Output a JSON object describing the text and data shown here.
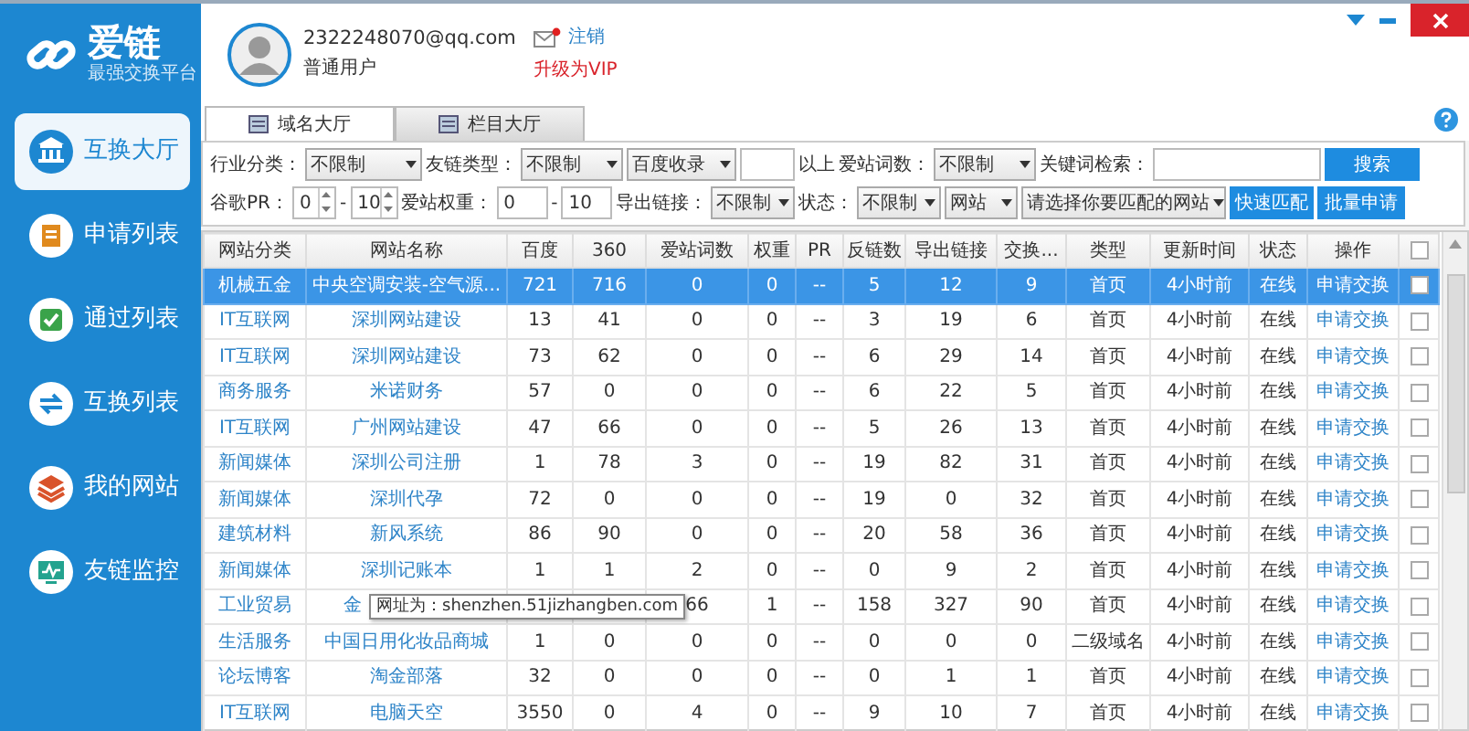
{
  "app": {
    "logo": "爱链",
    "tagline": "最强交换平台"
  },
  "sidebar": {
    "items": [
      {
        "label": "互换大厅",
        "selected": true,
        "kind": "bank"
      },
      {
        "label": "申请列表",
        "selected": false,
        "kind": "apply"
      },
      {
        "label": "通过列表",
        "selected": false,
        "kind": "check"
      },
      {
        "label": "互换列表",
        "selected": false,
        "kind": "swap"
      },
      {
        "label": "我的网站",
        "selected": false,
        "kind": "layers"
      },
      {
        "label": "友链监控",
        "selected": false,
        "kind": "monitor"
      }
    ]
  },
  "user": {
    "email": "2322248070@qq.com",
    "role": "普通用户",
    "logout": "注销",
    "upgrade": "升级为VIP",
    "unread": true
  },
  "tabs": [
    {
      "label": "域名大厅",
      "selected": true
    },
    {
      "label": "栏目大厅",
      "selected": false
    }
  ],
  "filters": [
    [
      {
        "kind": "label",
        "text": "行业分类："
      },
      {
        "kind": "select",
        "value": "不限制"
      },
      {
        "kind": "label",
        "text": "友链类型："
      },
      {
        "kind": "select",
        "value": "不限制"
      },
      {
        "kind": "select",
        "value": "百度收录"
      },
      {
        "kind": "input"
      },
      {
        "kind": "label",
        "text": "以上"
      },
      {
        "kind": "label",
        "text": "爱站词数："
      },
      {
        "kind": "select",
        "value": "不限制"
      },
      {
        "kind": "label",
        "text": "关键词检索："
      },
      {
        "kind": "input"
      },
      {
        "kind": "button",
        "text": "搜索"
      }
    ],
    [
      {
        "kind": "label",
        "text": "谷歌PR："
      },
      {
        "kind": "spin",
        "value": "0"
      },
      {
        "kind": "label",
        "text": "-"
      },
      {
        "kind": "spin",
        "value": "10"
      },
      {
        "kind": "label",
        "text": "爱站权重："
      },
      {
        "kind": "input",
        "value": "0"
      },
      {
        "kind": "label",
        "text": "-"
      },
      {
        "kind": "input",
        "value": "10"
      },
      {
        "kind": "label",
        "text": "导出链接："
      },
      {
        "kind": "select",
        "value": "不限制"
      },
      {
        "kind": "label",
        "text": "状态："
      },
      {
        "kind": "select",
        "value": "不限制"
      },
      {
        "kind": "select",
        "value": "网站"
      },
      {
        "kind": "select",
        "value": "请选择你要匹配的网站"
      },
      {
        "kind": "button",
        "text": "快速匹配"
      },
      {
        "kind": "button",
        "text": "批量申请"
      }
    ]
  ],
  "table": {
    "columns": [
      "网站分类",
      "网站名称",
      "百度",
      "360",
      "爱站词数",
      "权重",
      "PR",
      "反链数",
      "导出链接",
      "交换...",
      "类型",
      "更新时间",
      "状态",
      "操作"
    ],
    "header_checked": false,
    "rows": [
      {
        "selected": true,
        "checked": false,
        "cells": [
          "机械五金",
          "中央空调安装-空气源...",
          "721",
          "716",
          "0",
          "0",
          "--",
          "5",
          "12",
          "9",
          "首页",
          "4小时前",
          "在线",
          "申请交换"
        ]
      },
      {
        "selected": false,
        "checked": false,
        "cells": [
          "IT互联网",
          "深圳网站建设",
          "13",
          "41",
          "0",
          "0",
          "--",
          "3",
          "19",
          "6",
          "首页",
          "4小时前",
          "在线",
          "申请交换"
        ]
      },
      {
        "selected": false,
        "checked": false,
        "cells": [
          "IT互联网",
          "深圳网站建设",
          "73",
          "62",
          "0",
          "0",
          "--",
          "6",
          "29",
          "14",
          "首页",
          "4小时前",
          "在线",
          "申请交换"
        ]
      },
      {
        "selected": false,
        "checked": false,
        "cells": [
          "商务服务",
          "米诺财务",
          "57",
          "0",
          "0",
          "0",
          "--",
          "6",
          "22",
          "5",
          "首页",
          "4小时前",
          "在线",
          "申请交换"
        ]
      },
      {
        "selected": false,
        "checked": false,
        "cells": [
          "IT互联网",
          "广州网站建设",
          "47",
          "66",
          "0",
          "0",
          "--",
          "5",
          "26",
          "13",
          "首页",
          "4小时前",
          "在线",
          "申请交换"
        ]
      },
      {
        "selected": false,
        "checked": false,
        "cells": [
          "新闻媒体",
          "深圳公司注册",
          "1",
          "78",
          "3",
          "0",
          "--",
          "19",
          "82",
          "31",
          "首页",
          "4小时前",
          "在线",
          "申请交换"
        ]
      },
      {
        "selected": false,
        "checked": false,
        "cells": [
          "新闻媒体",
          "深圳代孕",
          "72",
          "0",
          "0",
          "0",
          "--",
          "19",
          "0",
          "32",
          "首页",
          "4小时前",
          "在线",
          "申请交换"
        ]
      },
      {
        "selected": false,
        "checked": false,
        "cells": [
          "建筑材料",
          "新风系统",
          "86",
          "90",
          "0",
          "0",
          "--",
          "20",
          "58",
          "36",
          "首页",
          "4小时前",
          "在线",
          "申请交换"
        ]
      },
      {
        "selected": false,
        "checked": false,
        "cells": [
          "新闻媒体",
          "深圳记账本",
          "1",
          "1",
          "2",
          "0",
          "--",
          "0",
          "9",
          "2",
          "首页",
          "4小时前",
          "在线",
          "申请交换"
        ]
      },
      {
        "selected": false,
        "checked": false,
        "tooltip": "网址为：shenzhen.51jizhangben.com",
        "cells": [
          "工业贸易",
          "金",
          null,
          null,
          "66",
          "1",
          "--",
          "158",
          "327",
          "90",
          "首页",
          "4小时前",
          "在线",
          "申请交换"
        ]
      },
      {
        "selected": false,
        "checked": false,
        "cells": [
          "生活服务",
          "中国日用化妆品商城",
          "1",
          "0",
          "0",
          "0",
          "--",
          "0",
          "0",
          "0",
          "二级域名",
          "4小时前",
          "在线",
          "申请交换"
        ]
      },
      {
        "selected": false,
        "checked": false,
        "cells": [
          "论坛博客",
          "淘金部落",
          "32",
          "0",
          "0",
          "0",
          "--",
          "0",
          "1",
          "1",
          "首页",
          "4小时前",
          "在线",
          "申请交换"
        ]
      },
      {
        "selected": false,
        "checked": false,
        "cells": [
          "IT互联网",
          "电脑天空",
          "3550",
          "0",
          "4",
          "0",
          "--",
          "9",
          "10",
          "7",
          "首页",
          "4小时前",
          "在线",
          "申请交换"
        ]
      }
    ]
  }
}
